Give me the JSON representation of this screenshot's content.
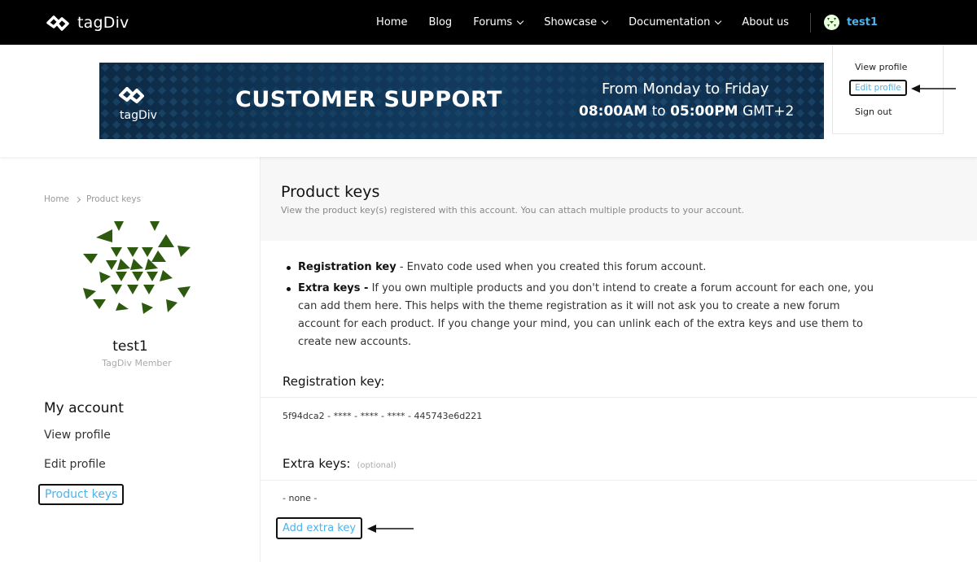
{
  "brand": {
    "name": "tagDiv"
  },
  "nav": {
    "items": [
      {
        "label": "Home",
        "dropdown": false
      },
      {
        "label": "Blog",
        "dropdown": false
      },
      {
        "label": "Forums",
        "dropdown": true
      },
      {
        "label": "Showcase",
        "dropdown": true
      },
      {
        "label": "Documentation",
        "dropdown": true
      },
      {
        "label": "About us",
        "dropdown": false
      }
    ],
    "user": "test1"
  },
  "user_menu": {
    "items": [
      "View profile",
      "Edit profile",
      "Sign out"
    ]
  },
  "banner": {
    "brand": "tagDiv",
    "headline": "CUSTOMER SUPPORT",
    "days": "From Monday to Friday",
    "hours_bold": "08:00AM",
    "hours_mid": "to",
    "hours_bold2": "05:00PM",
    "hours_tz": "GMT+2"
  },
  "breadcrumb": [
    "Home",
    "Product keys"
  ],
  "profile": {
    "name": "test1",
    "role": "TagDiv Member"
  },
  "sidebar": {
    "title": "My account",
    "links": [
      "View profile",
      "Edit profile",
      "Product keys"
    ]
  },
  "page": {
    "title": "Product keys",
    "subtitle": "View the product key(s) registered with this account. You can attach multiple products to your account.",
    "bullets": [
      {
        "term": "Registration key",
        "text": " - Envato code used when you created this forum account."
      },
      {
        "term": "Extra keys -",
        "text": " If you own multiple products and you don't intend to create a forum account for each one, you can add them here. This helps with the theme registration as it will not ask you to create a new forum account for each product. If you change your mind, you can unlink each of the extra keys and use them to create new accounts."
      }
    ],
    "registration_title": "Registration key:",
    "registration_value": "5f94dca2 - **** - **** - **** - 445743e6d221",
    "extra_title": "Extra keys:",
    "extra_optional": "(optional)",
    "extra_none": "- none -",
    "add_button": "Add extra key"
  },
  "colors": {
    "accent": "#4db2ec",
    "topbar": "#000000",
    "avatar_green": "#2d5a0e"
  }
}
